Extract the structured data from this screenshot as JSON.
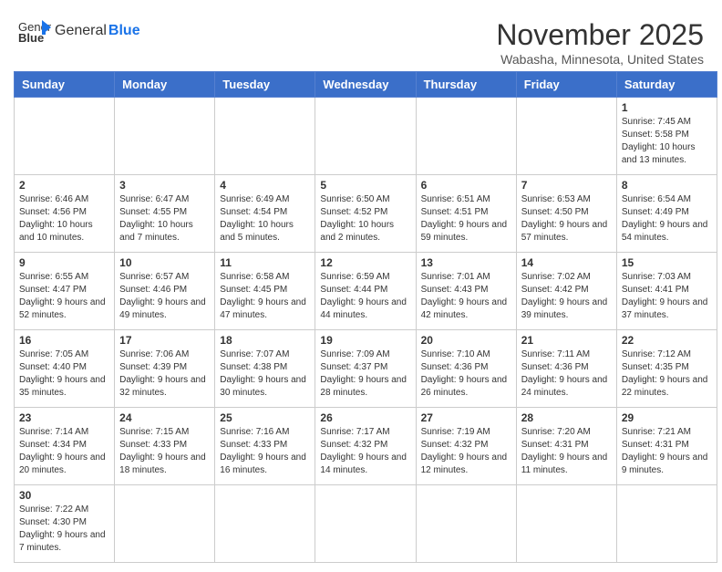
{
  "header": {
    "logo_text_regular": "General",
    "logo_text_bold": "Blue",
    "month_title": "November 2025",
    "location": "Wabasha, Minnesota, United States"
  },
  "weekdays": [
    "Sunday",
    "Monday",
    "Tuesday",
    "Wednesday",
    "Thursday",
    "Friday",
    "Saturday"
  ],
  "weeks": [
    [
      null,
      null,
      null,
      null,
      null,
      null,
      {
        "day": "1",
        "sunrise": "7:45 AM",
        "sunset": "5:58 PM",
        "daylight": "10 hours and 13 minutes."
      }
    ],
    [
      {
        "day": "2",
        "sunrise": "6:46 AM",
        "sunset": "4:56 PM",
        "daylight": "10 hours and 10 minutes."
      },
      {
        "day": "3",
        "sunrise": "6:47 AM",
        "sunset": "4:55 PM",
        "daylight": "10 hours and 7 minutes."
      },
      {
        "day": "4",
        "sunrise": "6:49 AM",
        "sunset": "4:54 PM",
        "daylight": "10 hours and 5 minutes."
      },
      {
        "day": "5",
        "sunrise": "6:50 AM",
        "sunset": "4:52 PM",
        "daylight": "10 hours and 2 minutes."
      },
      {
        "day": "6",
        "sunrise": "6:51 AM",
        "sunset": "4:51 PM",
        "daylight": "9 hours and 59 minutes."
      },
      {
        "day": "7",
        "sunrise": "6:53 AM",
        "sunset": "4:50 PM",
        "daylight": "9 hours and 57 minutes."
      },
      {
        "day": "8",
        "sunrise": "6:54 AM",
        "sunset": "4:49 PM",
        "daylight": "9 hours and 54 minutes."
      }
    ],
    [
      {
        "day": "9",
        "sunrise": "6:55 AM",
        "sunset": "4:47 PM",
        "daylight": "9 hours and 52 minutes."
      },
      {
        "day": "10",
        "sunrise": "6:57 AM",
        "sunset": "4:46 PM",
        "daylight": "9 hours and 49 minutes."
      },
      {
        "day": "11",
        "sunrise": "6:58 AM",
        "sunset": "4:45 PM",
        "daylight": "9 hours and 47 minutes."
      },
      {
        "day": "12",
        "sunrise": "6:59 AM",
        "sunset": "4:44 PM",
        "daylight": "9 hours and 44 minutes."
      },
      {
        "day": "13",
        "sunrise": "7:01 AM",
        "sunset": "4:43 PM",
        "daylight": "9 hours and 42 minutes."
      },
      {
        "day": "14",
        "sunrise": "7:02 AM",
        "sunset": "4:42 PM",
        "daylight": "9 hours and 39 minutes."
      },
      {
        "day": "15",
        "sunrise": "7:03 AM",
        "sunset": "4:41 PM",
        "daylight": "9 hours and 37 minutes."
      }
    ],
    [
      {
        "day": "16",
        "sunrise": "7:05 AM",
        "sunset": "4:40 PM",
        "daylight": "9 hours and 35 minutes."
      },
      {
        "day": "17",
        "sunrise": "7:06 AM",
        "sunset": "4:39 PM",
        "daylight": "9 hours and 32 minutes."
      },
      {
        "day": "18",
        "sunrise": "7:07 AM",
        "sunset": "4:38 PM",
        "daylight": "9 hours and 30 minutes."
      },
      {
        "day": "19",
        "sunrise": "7:09 AM",
        "sunset": "4:37 PM",
        "daylight": "9 hours and 28 minutes."
      },
      {
        "day": "20",
        "sunrise": "7:10 AM",
        "sunset": "4:36 PM",
        "daylight": "9 hours and 26 minutes."
      },
      {
        "day": "21",
        "sunrise": "7:11 AM",
        "sunset": "4:36 PM",
        "daylight": "9 hours and 24 minutes."
      },
      {
        "day": "22",
        "sunrise": "7:12 AM",
        "sunset": "4:35 PM",
        "daylight": "9 hours and 22 minutes."
      }
    ],
    [
      {
        "day": "23",
        "sunrise": "7:14 AM",
        "sunset": "4:34 PM",
        "daylight": "9 hours and 20 minutes."
      },
      {
        "day": "24",
        "sunrise": "7:15 AM",
        "sunset": "4:33 PM",
        "daylight": "9 hours and 18 minutes."
      },
      {
        "day": "25",
        "sunrise": "7:16 AM",
        "sunset": "4:33 PM",
        "daylight": "9 hours and 16 minutes."
      },
      {
        "day": "26",
        "sunrise": "7:17 AM",
        "sunset": "4:32 PM",
        "daylight": "9 hours and 14 minutes."
      },
      {
        "day": "27",
        "sunrise": "7:19 AM",
        "sunset": "4:32 PM",
        "daylight": "9 hours and 12 minutes."
      },
      {
        "day": "28",
        "sunrise": "7:20 AM",
        "sunset": "4:31 PM",
        "daylight": "9 hours and 11 minutes."
      },
      {
        "day": "29",
        "sunrise": "7:21 AM",
        "sunset": "4:31 PM",
        "daylight": "9 hours and 9 minutes."
      }
    ],
    [
      {
        "day": "30",
        "sunrise": "7:22 AM",
        "sunset": "4:30 PM",
        "daylight": "9 hours and 7 minutes."
      },
      null,
      null,
      null,
      null,
      null,
      null
    ]
  ]
}
